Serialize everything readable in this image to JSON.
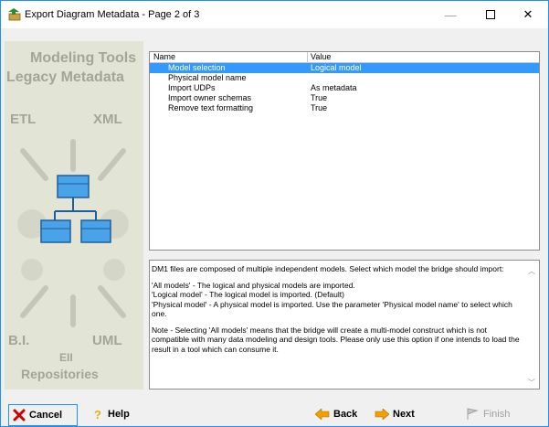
{
  "window": {
    "title": "Export Diagram Metadata - Page 2 of 3",
    "minimize_symbol": "—",
    "close_symbol": "✕"
  },
  "side_panel": {
    "lines": [
      "Modeling Tools",
      "Legacy Metadata",
      "ETL",
      "XML",
      "B.I.",
      "UML",
      "EII",
      "Repositories"
    ]
  },
  "properties": {
    "columns": [
      "Name",
      "Value"
    ],
    "rows": [
      {
        "name": "Model selection",
        "value": "Logical model",
        "selected": true
      },
      {
        "name": "Physical model name",
        "value": ""
      },
      {
        "name": "Import UDPs",
        "value": "As metadata"
      },
      {
        "name": "Import owner schemas",
        "value": "True"
      },
      {
        "name": "Remove text formatting",
        "value": "True"
      }
    ]
  },
  "description": {
    "paragraphs": [
      "DM1 files are composed of multiple independent models.  Select which model the bridge should import:",
      "'All models' - The logical and physical models are imported.\n'Logical model' - The logical model is imported. (Default)\n'Physical model' - A physical model is imported. Use the parameter 'Physical model name' to select which one.",
      "Note - Selecting 'All models' means that the bridge will create a multi-model construct which is not compatible with many data modeling and design tools. Please only use this option if one intends to load the result in a tool which can consume it."
    ]
  },
  "buttons": {
    "cancel": "Cancel",
    "help": "Help",
    "back": "Back",
    "next": "Next",
    "finish": "Finish"
  },
  "colors": {
    "selection": "#3399ff",
    "window_border": "#1e90ff",
    "cancel_icon": "#cc0000",
    "arrow_icon": "#f0a000"
  }
}
